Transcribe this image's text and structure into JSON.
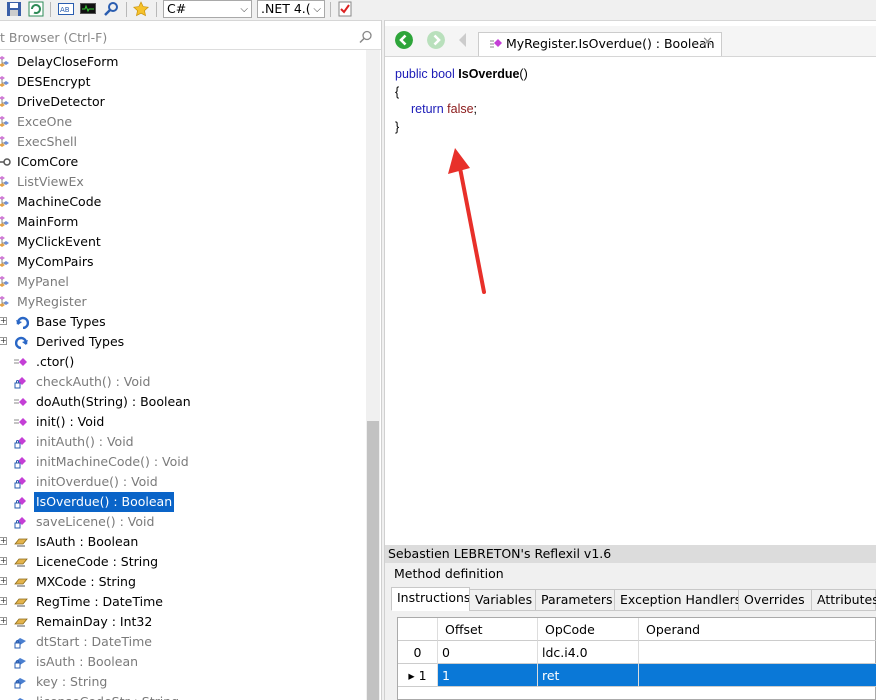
{
  "toolbar": {
    "language": "C#",
    "framework": ".NET 4.(",
    "icons": [
      "save-icon",
      "refresh-icon",
      "ab-icon",
      "monitor-icon",
      "search-icon",
      "star-icon",
      "checklist-icon"
    ]
  },
  "browser": {
    "search_placeholder": "t Browser (Ctrl-F)",
    "items": [
      {
        "label": "DelayCloseForm",
        "kind": "class",
        "grey": false
      },
      {
        "label": "DESEncrypt",
        "kind": "class",
        "grey": false
      },
      {
        "label": "DriveDetector",
        "kind": "class",
        "grey": false
      },
      {
        "label": "ExceOne",
        "kind": "class",
        "grey": true
      },
      {
        "label": "ExecShell",
        "kind": "class",
        "grey": true
      },
      {
        "label": "IComCore",
        "kind": "interface",
        "grey": false
      },
      {
        "label": "ListViewEx",
        "kind": "class",
        "grey": true
      },
      {
        "label": "MachineCode",
        "kind": "class",
        "grey": false
      },
      {
        "label": "MainForm",
        "kind": "class",
        "grey": false
      },
      {
        "label": "MyClickEvent",
        "kind": "class",
        "grey": false
      },
      {
        "label": "MyComPairs",
        "kind": "class",
        "grey": false
      },
      {
        "label": "MyPanel",
        "kind": "class",
        "grey": true
      },
      {
        "label": "MyRegister",
        "kind": "class",
        "grey": true
      },
      {
        "label": "Base Types",
        "kind": "basetypes",
        "grey": false
      },
      {
        "label": "Derived Types",
        "kind": "derivedtypes",
        "grey": false
      },
      {
        "label": ".ctor()",
        "kind": "method",
        "grey": false
      },
      {
        "label": "checkAuth() : Void",
        "kind": "private-method",
        "grey": true
      },
      {
        "label": "doAuth(String) : Boolean",
        "kind": "method",
        "grey": false
      },
      {
        "label": "init() : Void",
        "kind": "method",
        "grey": false
      },
      {
        "label": "initAuth() : Void",
        "kind": "private-method",
        "grey": true
      },
      {
        "label": "initMachineCode() : Void",
        "kind": "private-method",
        "grey": true
      },
      {
        "label": "initOverdue() : Void",
        "kind": "private-method",
        "grey": true
      },
      {
        "label": "IsOverdue() : Boolean",
        "kind": "private-method",
        "grey": false,
        "selected": true
      },
      {
        "label": "saveLicene() : Void",
        "kind": "private-method",
        "grey": true
      },
      {
        "label": "IsAuth : Boolean",
        "kind": "property",
        "grey": false
      },
      {
        "label": "LiceneCode : String",
        "kind": "property",
        "grey": false
      },
      {
        "label": "MXCode : String",
        "kind": "property",
        "grey": false
      },
      {
        "label": "RegTime : DateTime",
        "kind": "property",
        "grey": false
      },
      {
        "label": "RemainDay : Int32",
        "kind": "property",
        "grey": false
      },
      {
        "label": "dtStart : DateTime",
        "kind": "field",
        "grey": true
      },
      {
        "label": "isAuth : Boolean",
        "kind": "field",
        "grey": true
      },
      {
        "label": "key : String",
        "kind": "field",
        "grey": true
      },
      {
        "label": "licenseCodeStr : String",
        "kind": "field",
        "grey": true
      }
    ]
  },
  "editor": {
    "tab_title": "MyRegister.IsOverdue() : Boolean",
    "code": {
      "kw_public": "public",
      "kw_bool": "bool",
      "method_name": "IsOverdue",
      "parens": "()",
      "open_brace": "{",
      "kw_return": "return",
      "kw_false": "false",
      "semicolon": ";",
      "close_brace": "}"
    }
  },
  "reflexil": {
    "title": "Sebastien LEBRETON's Reflexil v1.6",
    "section": "Method definition",
    "tabs": [
      "Instructions",
      "Variables",
      "Parameters",
      "Exception Handlers",
      "Overrides",
      "Attributes"
    ],
    "active_tab": "Instructions",
    "columns": [
      "Offset",
      "OpCode",
      "Operand"
    ],
    "rows": [
      {
        "index": "0",
        "offset": "0",
        "opcode": "ldc.i4.0",
        "operand": ""
      },
      {
        "index": "1",
        "offset": "1",
        "opcode": "ret",
        "operand": ""
      }
    ],
    "selected_row": "1"
  },
  "colors": {
    "selection": "#0a64c8",
    "grid_selection": "#0a78d7",
    "keyword": "#1b1bb7",
    "annotation_arrow": "#e8302a"
  }
}
